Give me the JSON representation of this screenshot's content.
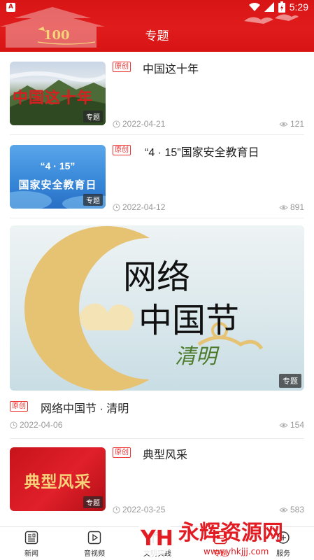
{
  "status_bar": {
    "time": "5:29",
    "warning_glyph": "A"
  },
  "header": {
    "title": "专题",
    "emblem_text": "100"
  },
  "feed": {
    "original_label": "原创",
    "items": [
      {
        "title": "中国这十年",
        "thumb_text": "中国这十年",
        "tag": "专题",
        "date": "2022-04-21",
        "views": "121"
      },
      {
        "title": "“4 · 15”国家安全教育日",
        "thumb_text_top": "“4 · 15”",
        "thumb_text": "国家安全教育日",
        "tag": "专题",
        "date": "2022-04-12",
        "views": "891"
      },
      {
        "title": "网络中国节 · 清明",
        "thumb_text_line1": "网络",
        "thumb_text_line2": "中国节",
        "thumb_text_line3": "清明",
        "tag": "专题",
        "date": "2022-04-06",
        "views": "154"
      },
      {
        "title": "典型风采",
        "thumb_text": "典型风采",
        "tag": "专题",
        "date": "2022-03-25",
        "views": "583"
      }
    ]
  },
  "bottom_nav": {
    "tabs": [
      {
        "label": "新闻",
        "icon": "news-icon"
      },
      {
        "label": "音视频",
        "icon": "video-icon"
      },
      {
        "label": "文明实践",
        "icon": "practice-icon"
      },
      {
        "label": "专题",
        "icon": "topic-icon"
      },
      {
        "label": "服务",
        "icon": "service-icon"
      }
    ]
  },
  "watermark": {
    "brand": "永辉资源网",
    "url": "www.yhkjjj.com",
    "logo_text": "YH"
  },
  "colors": {
    "brand_red": "#d71414",
    "original_red": "#e33333",
    "meta_gray": "#999999"
  }
}
